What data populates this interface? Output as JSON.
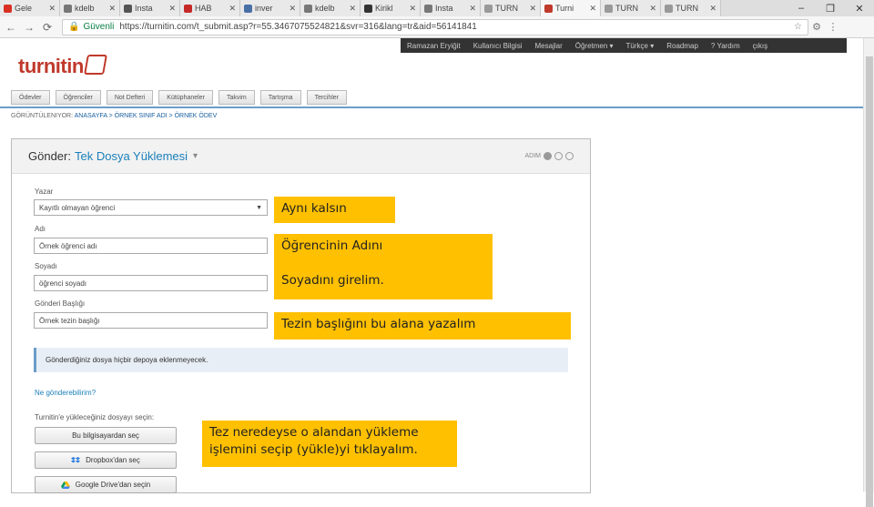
{
  "browser": {
    "tabs": [
      {
        "title": "Gele",
        "color": "#d93025"
      },
      {
        "title": "kdelb",
        "color": "#777777"
      },
      {
        "title": "Insta",
        "color": "#555555"
      },
      {
        "title": "HAB",
        "color": "#c62828"
      },
      {
        "title": "inver",
        "color": "#4a6fa5"
      },
      {
        "title": "kdelb",
        "color": "#777777"
      },
      {
        "title": "Kirikl",
        "color": "#333333"
      },
      {
        "title": "Insta",
        "color": "#777777"
      },
      {
        "title": "TURN",
        "color": "#999999"
      },
      {
        "title": "Turni",
        "color": "#c0392b"
      },
      {
        "title": "TURN",
        "color": "#999999"
      },
      {
        "title": "TURN",
        "color": "#999999"
      }
    ],
    "security_label": "Güvenli",
    "url": "https://turnitin.com/t_submit.asp?r=55.3467075524821&svr=316&lang=tr&aid=56141841"
  },
  "site": {
    "topnav": [
      "Ramazan Eryiğit",
      "Kullanıcı Bilgisi",
      "Mesajlar",
      "Öğretmen ▾",
      "Türkçe ▾",
      "Roadmap",
      "? Yardım",
      "çıkış"
    ],
    "logo": "turnitin",
    "subnav": [
      "Ödevler",
      "Öğrenciler",
      "Not Defteri",
      "Kütüphaneler",
      "Takvim",
      "Tartışma",
      "Tercihler"
    ],
    "crumb_prefix": "GÖRÜNTÜLENIYOR:",
    "crumb_path": "ANASAYFA > ÖRNEK SINIF ADI > ÖRNEK ÖDEV"
  },
  "panel": {
    "title_prefix": "Gönder:",
    "title": "Tek Dosya Yüklemesi",
    "title_dropdown": "▾",
    "step_label": "ADIM",
    "author_label": "Yazar",
    "author_value": "Kayıtlı olmayan öğrenci",
    "first_label": "Adı",
    "first_value": "Örnek öğrenci adı",
    "last_label": "Soyadı",
    "last_value": "öğrenci soyadı",
    "subject_label": "Gönderi Başlığı",
    "subject_value": "Örnek tezin başlığı",
    "info": "Gönderdiğiniz dosya hiçbir depoya eklenmeyecek.",
    "help_link": "Ne gönderebilirim?",
    "upload_label": "Turnitin'e yükleceğiniz dosyayı seçin:",
    "btn_computer": "Bu bilgisayardan seç",
    "btn_dropbox": "Dropbox'dan seç",
    "btn_gdrive": "Google Drive'dan seçin"
  },
  "notes": {
    "same": "Aynı kalsın",
    "name_line1": "Öğrencinin Adını",
    "name_line2": "Soyadını girelim.",
    "title": "Tezin başlığını bu alana yazalım",
    "upload": "Tez neredeyse o alandan yükleme işlemini seçip (yükle)yi tıklayalım."
  }
}
